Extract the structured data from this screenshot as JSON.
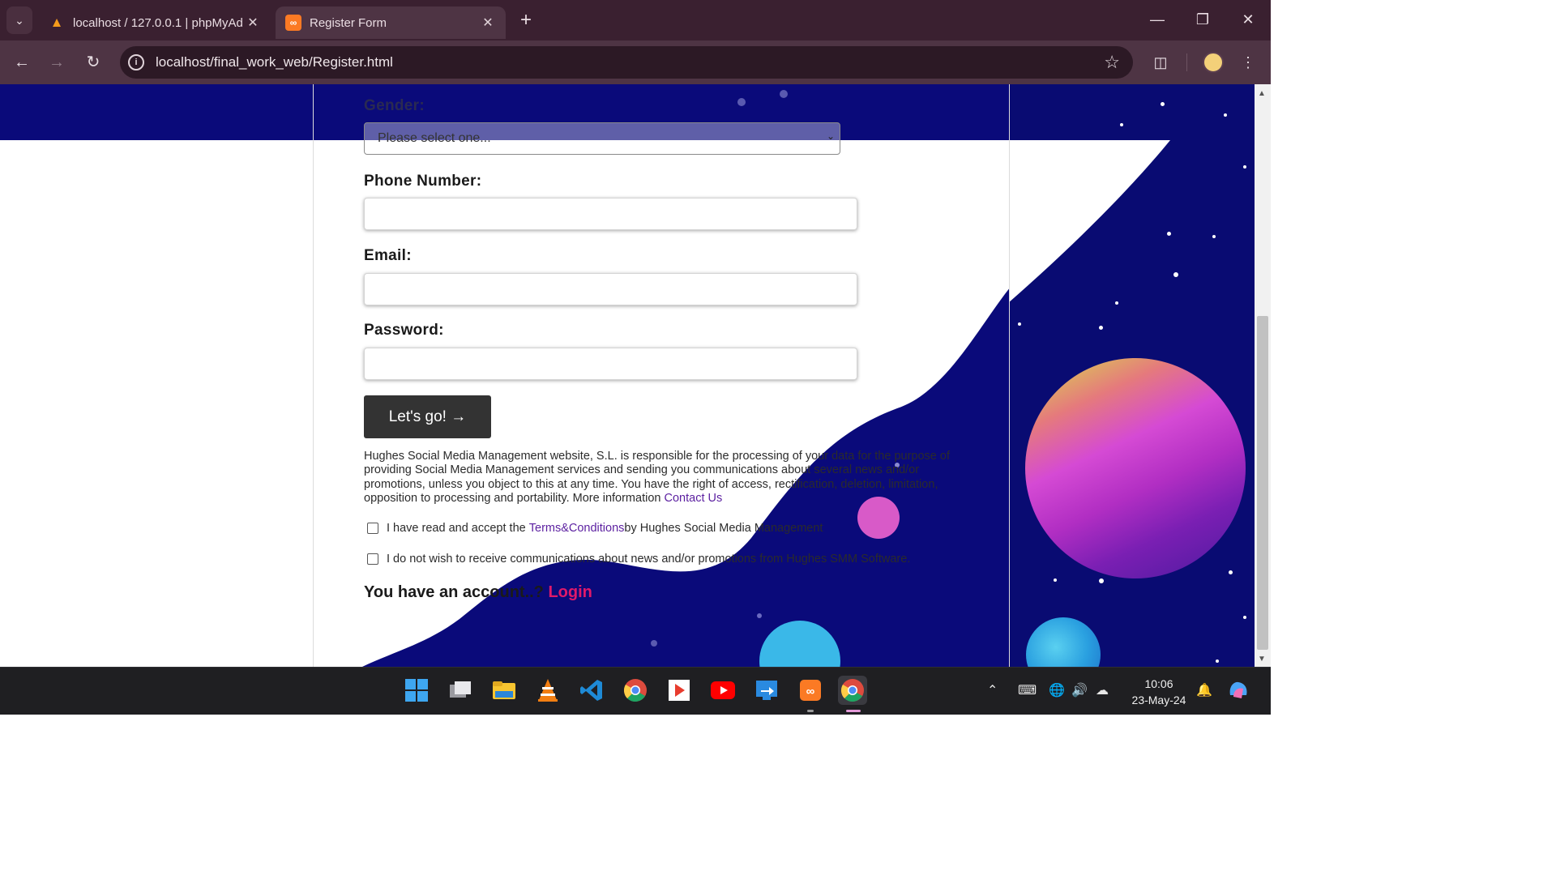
{
  "browser": {
    "tabs": [
      {
        "title": "localhost / 127.0.0.1 | phpMyAd",
        "active": false,
        "icon": "phpmyadmin-icon"
      },
      {
        "title": "Register Form",
        "active": true,
        "icon": "xampp-icon"
      }
    ],
    "url": "localhost/final_work_web/Register.html",
    "new_tab_symbol": "+"
  },
  "form": {
    "gender_label": "Gender:",
    "gender_select_value": "Please select one...",
    "phone_label": "Phone Number:",
    "email_label": "Email:",
    "password_label": "Password:",
    "submit_label": "Let's go! →",
    "legal_text": "Hughes Social Media Management website, S.L. is responsible for the processing of your data for the purpose of providing Social Media Management services and sending you communications about several news and/or promotions, unless you object to this at any time. You have the right of access, rectification, deletion, limitation, opposition to processing and portability. More information ",
    "legal_link": "Contact Us",
    "terms_prefix": "I have read and accept the ",
    "terms_link": "Terms&Conditions",
    "terms_suffix": " by Hughes Social Media Management",
    "optout_text": "I do not wish to receive communications about news and/or promotions from Hughes SMM Software.",
    "account_prompt": "You have an account..? ",
    "login_link": "Login"
  },
  "taskbar": {
    "apps": [
      "windows-start",
      "task-view",
      "file-explorer",
      "vlc",
      "vscode",
      "chrome",
      "media-player",
      "youtube",
      "remote-desktop",
      "xampp",
      "chrome-profile"
    ],
    "time": "10:06",
    "date": "23-May-24"
  },
  "colors": {
    "space_navy": "#0a0a7a",
    "login_pink": "#e0196a",
    "link_purple": "#5b1fa0",
    "button_dark": "#333333"
  }
}
